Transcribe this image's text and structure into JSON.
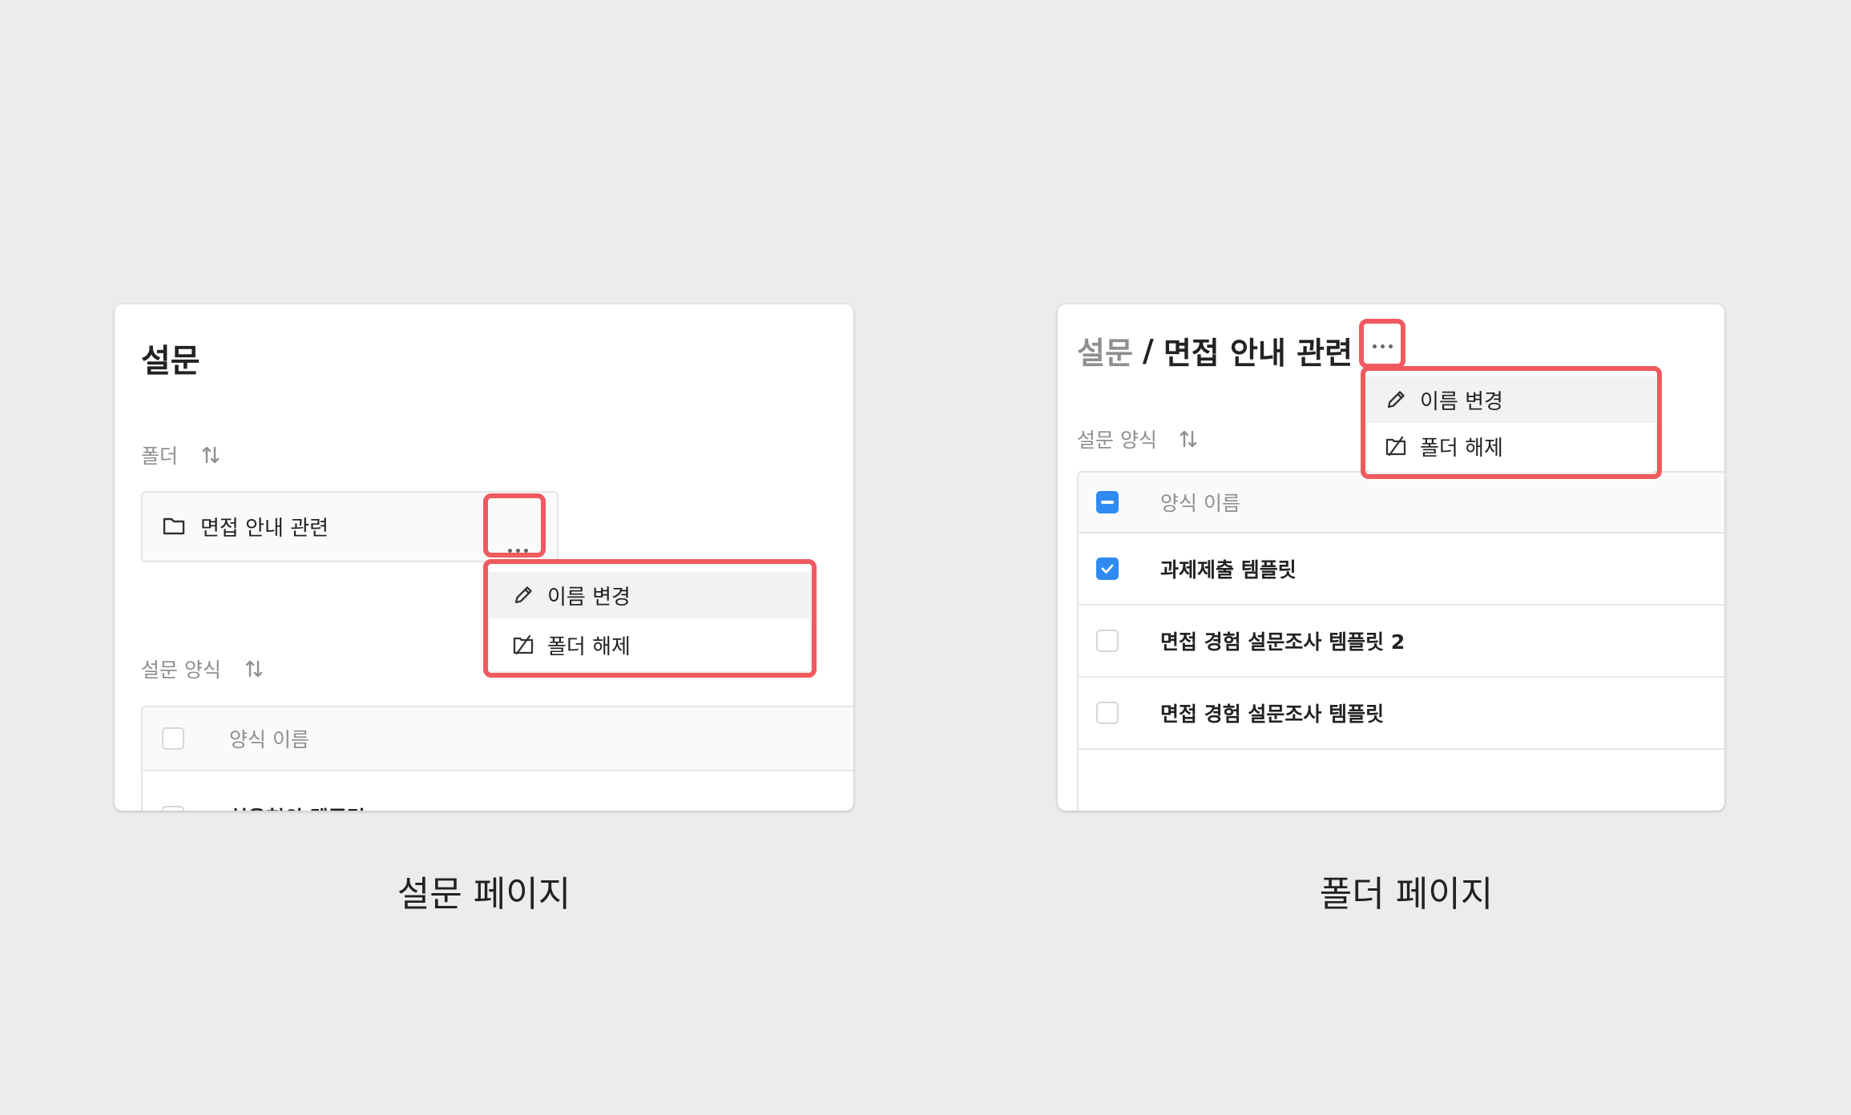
{
  "survey_page": {
    "title": "설문",
    "folder_section_label": "폴더",
    "folder_item": {
      "icon": "folder-icon",
      "name": "면접 안내 관련"
    },
    "more_icon": "more-horizontal-icon",
    "context_menu": [
      {
        "icon": "pencil-icon",
        "label": "이름 변경"
      },
      {
        "icon": "folder-off-icon",
        "label": "폴더 해제"
      }
    ],
    "forms_section_label": "설문 양식",
    "table_header": "양식 이름",
    "rows": [
      {
        "name": "처음형의 템플릿"
      }
    ],
    "caption": "설문 페이지"
  },
  "folder_page": {
    "breadcrumb_root": "설문",
    "breadcrumb_separator": "/",
    "breadcrumb_current": "면접 안내 관련",
    "more_icon": "more-horizontal-icon",
    "context_menu": [
      {
        "icon": "pencil-icon",
        "label": "이름 변경"
      },
      {
        "icon": "folder-off-icon",
        "label": "폴더 해제"
      }
    ],
    "forms_section_label": "설문 양식",
    "table_header": "양식 이름",
    "header_checkbox_state": "indeterminate",
    "rows": [
      {
        "name": "과제제출 템플릿",
        "checked": true
      },
      {
        "name": "면접 경험 설문조사 템플릿 2",
        "checked": false
      },
      {
        "name": "면접 경험 설문조사 템플릿",
        "checked": false
      }
    ],
    "caption": "폴더 페이지"
  },
  "colors": {
    "highlight": "#ef5a5f",
    "checkbox_accent": "#2f8bf1",
    "background": "#ececec"
  }
}
